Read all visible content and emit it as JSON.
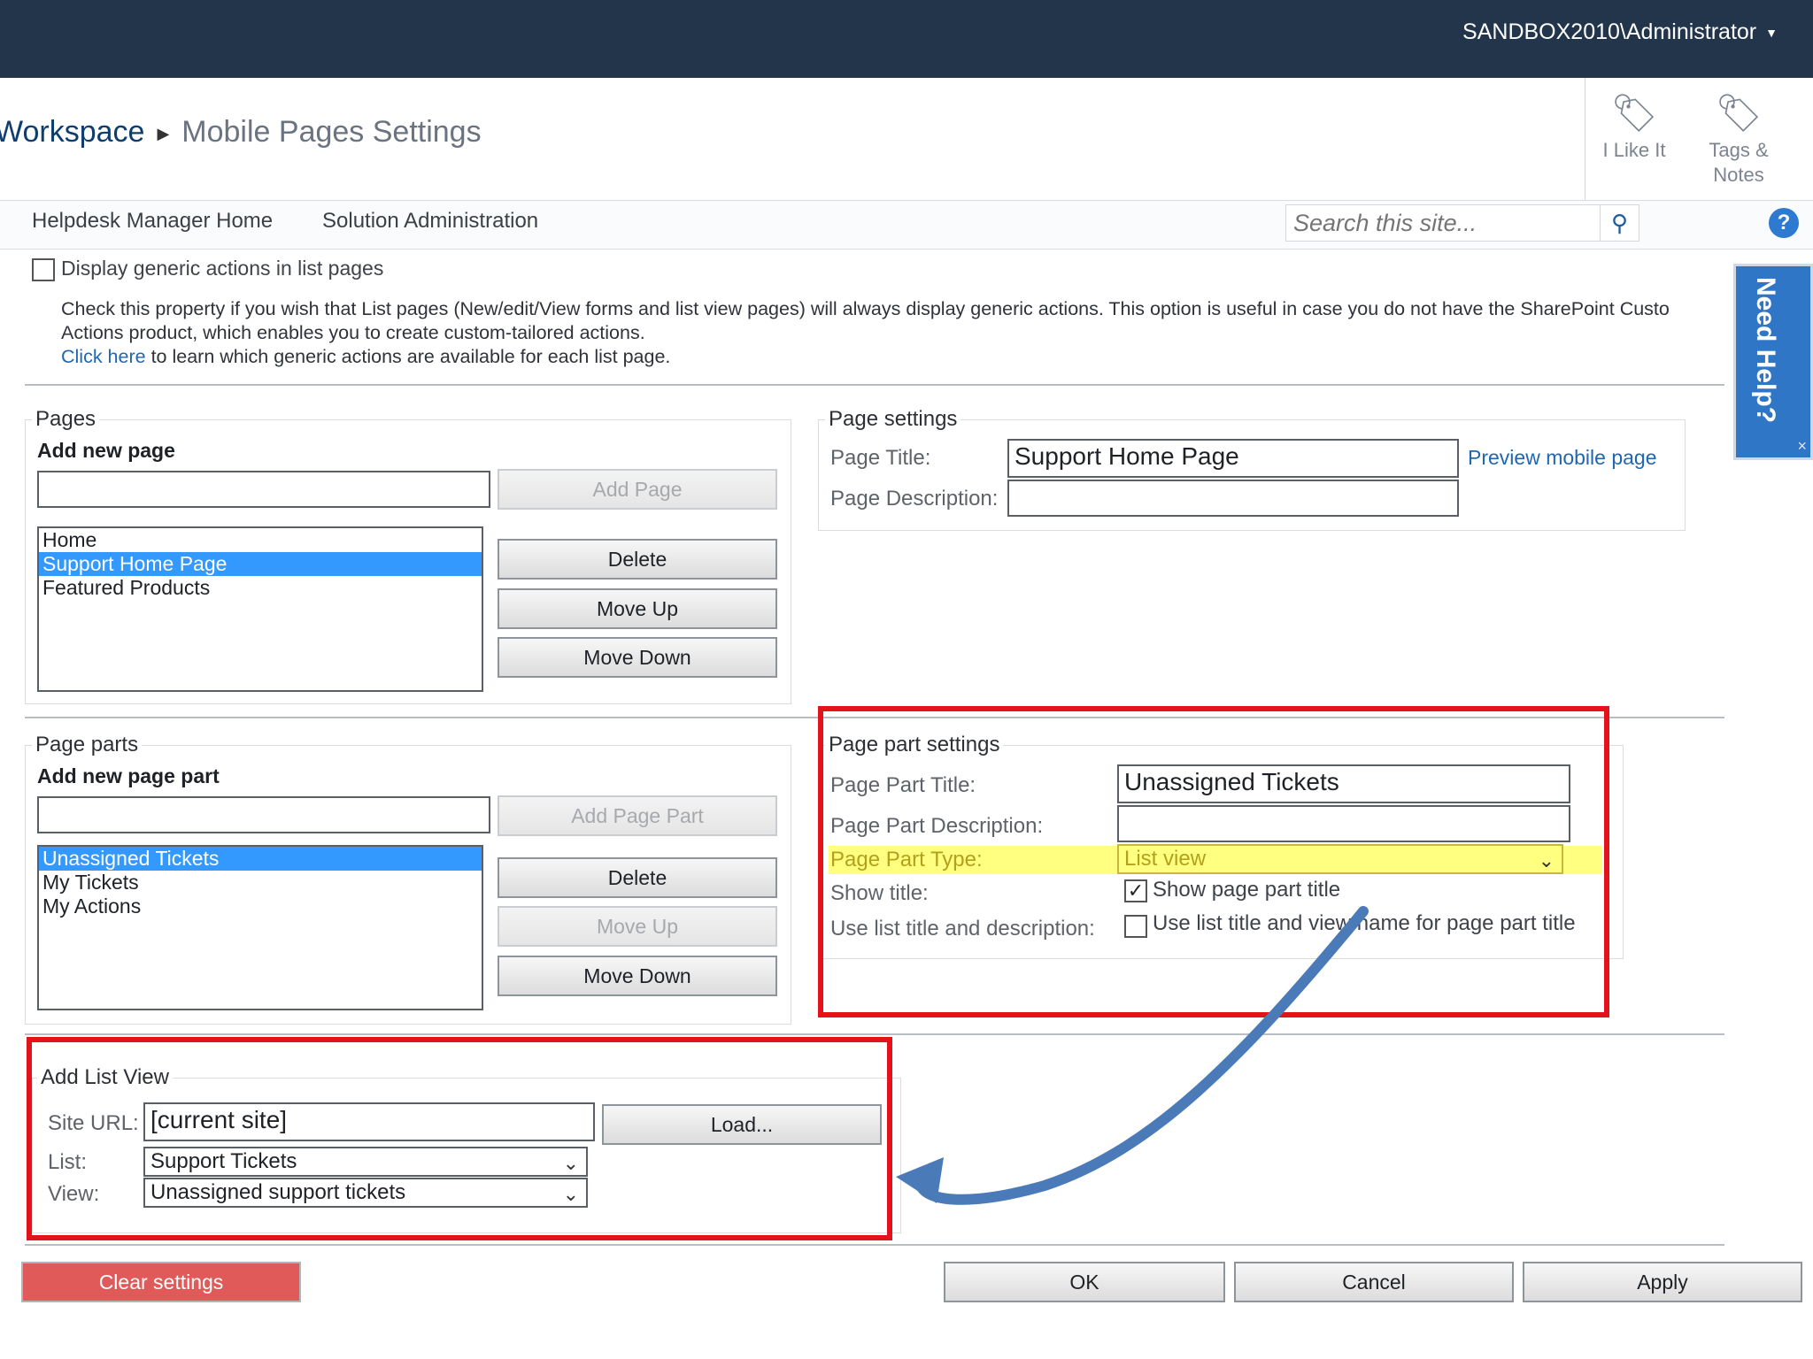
{
  "user_menu": {
    "label": "SANDBOX2010\\Administrator"
  },
  "breadcrumb": {
    "parent": "Workspace",
    "current": "Mobile Pages Settings"
  },
  "social": {
    "like_label": "I Like It",
    "tags_label_1": "Tags &",
    "tags_label_2": "Notes"
  },
  "nav": {
    "item1": "Helpdesk Manager Home",
    "item2": "Solution Administration"
  },
  "search": {
    "placeholder": "Search this site..."
  },
  "need_help": {
    "label": "Need Help?",
    "close": "×"
  },
  "generic_actions": {
    "label": "Display generic actions in list pages",
    "desc_line1": "Check this property if you wish that List pages (New/edit/View forms and list view pages) will always display generic actions. This option is useful in case you do not have the SharePoint Custo",
    "desc_line2": "Actions product, which enables you to create custom-tailored actions.",
    "link": "Click here",
    "desc_line3": " to learn which generic actions are available for each list page."
  },
  "pages": {
    "legend": "Pages",
    "add_heading": "Add new page",
    "new_page_value": "",
    "add_button": "Add Page",
    "items": [
      "Home",
      "Support Home Page",
      "Featured Products"
    ],
    "selected": "Support Home Page",
    "delete_button": "Delete",
    "move_up_button": "Move Up",
    "move_down_button": "Move Down"
  },
  "page_settings": {
    "legend": "Page settings",
    "title_label": "Page Title:",
    "title_value": "Support Home Page",
    "desc_label": "Page Description:",
    "desc_value": "",
    "preview_link": "Preview mobile page"
  },
  "page_parts": {
    "legend": "Page parts",
    "add_heading": "Add new page part",
    "new_part_value": "",
    "add_button": "Add Page Part",
    "items": [
      "Unassigned Tickets",
      "My Tickets",
      "My Actions"
    ],
    "selected": "Unassigned Tickets",
    "delete_button": "Delete",
    "move_up_button": "Move Up",
    "move_down_button": "Move Down"
  },
  "page_part_settings": {
    "legend": "Page part settings",
    "title_label": "Page Part Title:",
    "title_value": "Unassigned Tickets",
    "desc_label": "Page Part Description:",
    "desc_value": "",
    "type_label": "Page Part Type:",
    "type_value": "List view",
    "show_title_label": "Show title:",
    "show_title_checkbox": "Show page part title",
    "show_title_checked": true,
    "use_list_label": "Use list title and description:",
    "use_list_checkbox": "Use list title and view name for page part title",
    "use_list_checked": false
  },
  "add_list_view": {
    "legend": "Add List View",
    "site_url_label": "Site URL:",
    "site_url_value": "[current site]",
    "load_button": "Load...",
    "list_label": "List:",
    "list_value": "Support Tickets",
    "view_label": "View:",
    "view_value": "Unassigned support tickets"
  },
  "footer": {
    "clear_button": "Clear settings",
    "ok_button": "OK",
    "cancel_button": "Cancel",
    "apply_button": "Apply"
  },
  "colors": {
    "topbar": "#22354b",
    "highlight_red": "#e4121a",
    "type_row_highlight": "#ffff80",
    "arrow_blue": "#4a7ab8",
    "clear_button": "#e05a5a",
    "list_selection": "#3399ff"
  }
}
